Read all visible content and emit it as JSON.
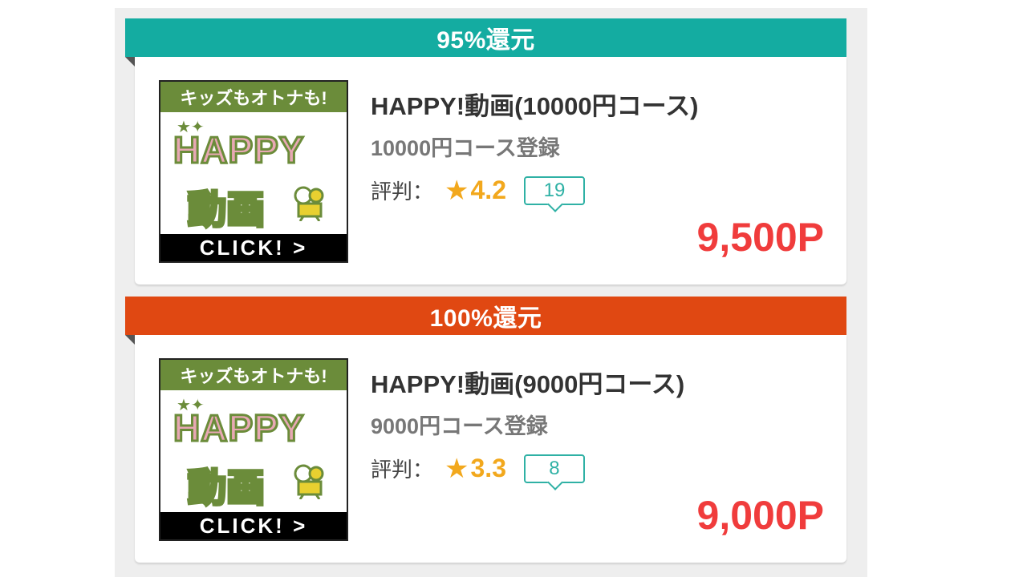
{
  "offers": [
    {
      "ribbon": "95%還元",
      "ribbon_color": "#14aca1",
      "thumbnail": {
        "top_text": "キッズもオトナも!",
        "logo_text": "HAPPY",
        "logo_sub": "動画",
        "button_text": "CLICK! >"
      },
      "title": "HAPPY!動画(10000円コース)",
      "subtitle": "10000円コース登録",
      "rating_label": "評判：",
      "rating_star": "★",
      "rating_value": "4.2",
      "review_count": "19",
      "points": "9,500P"
    },
    {
      "ribbon": "100%還元",
      "ribbon_color": "#e04812",
      "thumbnail": {
        "top_text": "キッズもオトナも!",
        "logo_text": "HAPPY",
        "logo_sub": "動画",
        "button_text": "CLICK! >"
      },
      "title": "HAPPY!動画(9000円コース)",
      "subtitle": "9000円コース登録",
      "rating_label": "評判：",
      "rating_star": "★",
      "rating_value": "3.3",
      "review_count": "8",
      "points": "9,000P"
    }
  ]
}
